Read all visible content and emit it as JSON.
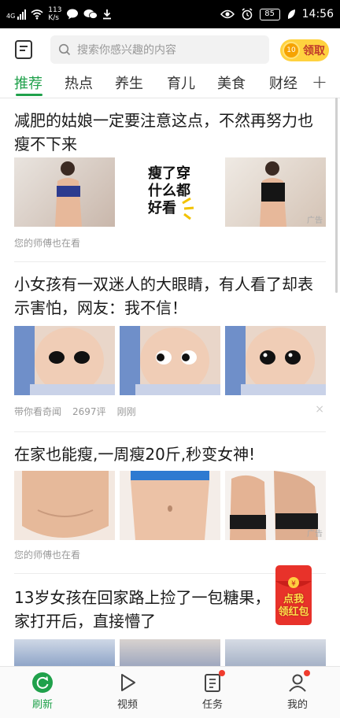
{
  "status_bar": {
    "signal": "4G",
    "net_speed_value": "113",
    "net_speed_unit": "K/s",
    "battery": "85",
    "time": "14:56"
  },
  "header": {
    "search_placeholder": "搜索你感兴趣的内容",
    "coin_value": "10",
    "claim_label": "领取"
  },
  "tabs": [
    "推荐",
    "热点",
    "养生",
    "育儿",
    "美食",
    "财经"
  ],
  "articles": [
    {
      "title": "减肥的姑娘一定要注意这点，不然再努力也瘦不下来",
      "banner_text": [
        "瘦了穿",
        "什么都",
        "好看"
      ],
      "ad_mark": "广告",
      "meta": [
        "您的师傅也在看"
      ]
    },
    {
      "title": "小女孩有一双迷人的大眼睛，有人看了却表示害怕，网友：我不信！",
      "meta": [
        "带你看奇闻",
        "2697评",
        "刚刚"
      ],
      "dismiss": "×"
    },
    {
      "title": "在家也能瘦,一周瘦20斤,秒变女神!",
      "ad_mark": "广告",
      "meta": [
        "您的师傅也在看"
      ]
    },
    {
      "title": "13岁女孩在回家路上捡了一包糖果，家打开后，直接懵了"
    }
  ],
  "red_envelope": {
    "line1": "点我",
    "line2": "领红包"
  },
  "bottom_nav": [
    {
      "label": "刷新",
      "icon": "refresh-icon"
    },
    {
      "label": "视频",
      "icon": "play-icon"
    },
    {
      "label": "任务",
      "icon": "task-icon"
    },
    {
      "label": "我的",
      "icon": "profile-icon"
    }
  ],
  "colors": {
    "accent": "#20a14b",
    "coin": "#ffd23f",
    "badge": "#f03c2e"
  }
}
